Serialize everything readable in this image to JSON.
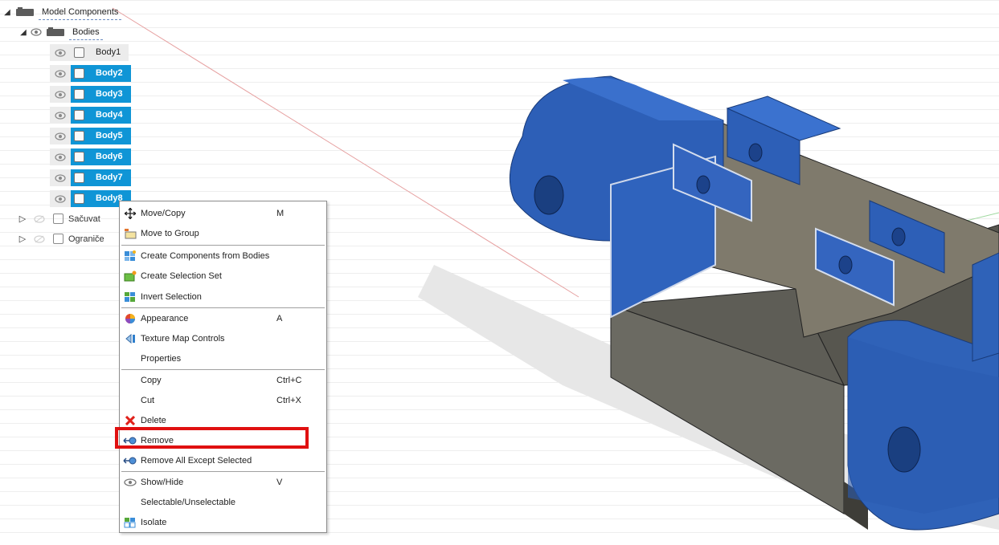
{
  "browser": {
    "root_label": "Model Components",
    "bodies_folder_label": "Bodies",
    "bodies": [
      {
        "label": "Body1",
        "selected": false
      },
      {
        "label": "Body2",
        "selected": true
      },
      {
        "label": "Body3",
        "selected": true
      },
      {
        "label": "Body4",
        "selected": true
      },
      {
        "label": "Body5",
        "selected": true
      },
      {
        "label": "Body6",
        "selected": true
      },
      {
        "label": "Body7",
        "selected": true
      },
      {
        "label": "Body8",
        "selected": true
      }
    ],
    "groups": [
      {
        "label": "Sačuvat"
      },
      {
        "label": "Ograniče"
      }
    ]
  },
  "context_menu": {
    "items": [
      {
        "label": "Move/Copy",
        "shortcut": "M",
        "icon": "move-copy-icon"
      },
      {
        "label": "Move to Group",
        "shortcut": "",
        "icon": "move-to-group-icon"
      },
      {
        "label": "Create Components from Bodies",
        "shortcut": "",
        "icon": "create-components-icon"
      },
      {
        "label": "Create Selection Set",
        "shortcut": "",
        "icon": "selection-set-icon"
      },
      {
        "label": "Invert Selection",
        "shortcut": "",
        "icon": "invert-selection-icon"
      },
      {
        "label": "Appearance",
        "shortcut": "A",
        "icon": "appearance-icon"
      },
      {
        "label": "Texture Map Controls",
        "shortcut": "",
        "icon": "texture-map-icon"
      },
      {
        "label": "Properties",
        "shortcut": "",
        "icon": ""
      },
      {
        "label": "Copy",
        "shortcut": "Ctrl+C",
        "icon": ""
      },
      {
        "label": "Cut",
        "shortcut": "Ctrl+X",
        "icon": ""
      },
      {
        "label": "Delete",
        "shortcut": "",
        "icon": "delete-icon"
      },
      {
        "label": "Remove",
        "shortcut": "",
        "icon": "remove-icon"
      },
      {
        "label": "Remove All Except Selected",
        "shortcut": "",
        "icon": "remove-all-except-icon"
      },
      {
        "label": "Show/Hide",
        "shortcut": "V",
        "icon": "eye-icon"
      },
      {
        "label": "Selectable/Unselectable",
        "shortcut": "",
        "icon": ""
      },
      {
        "label": "Isolate",
        "shortcut": "",
        "icon": "isolate-icon"
      }
    ],
    "highlighted_item": "Remove"
  },
  "colors": {
    "selection": "#0f95d6",
    "body_blue": "#2f62b8",
    "body_gray": "#6b6a62",
    "highlight_box": "#e01010"
  }
}
